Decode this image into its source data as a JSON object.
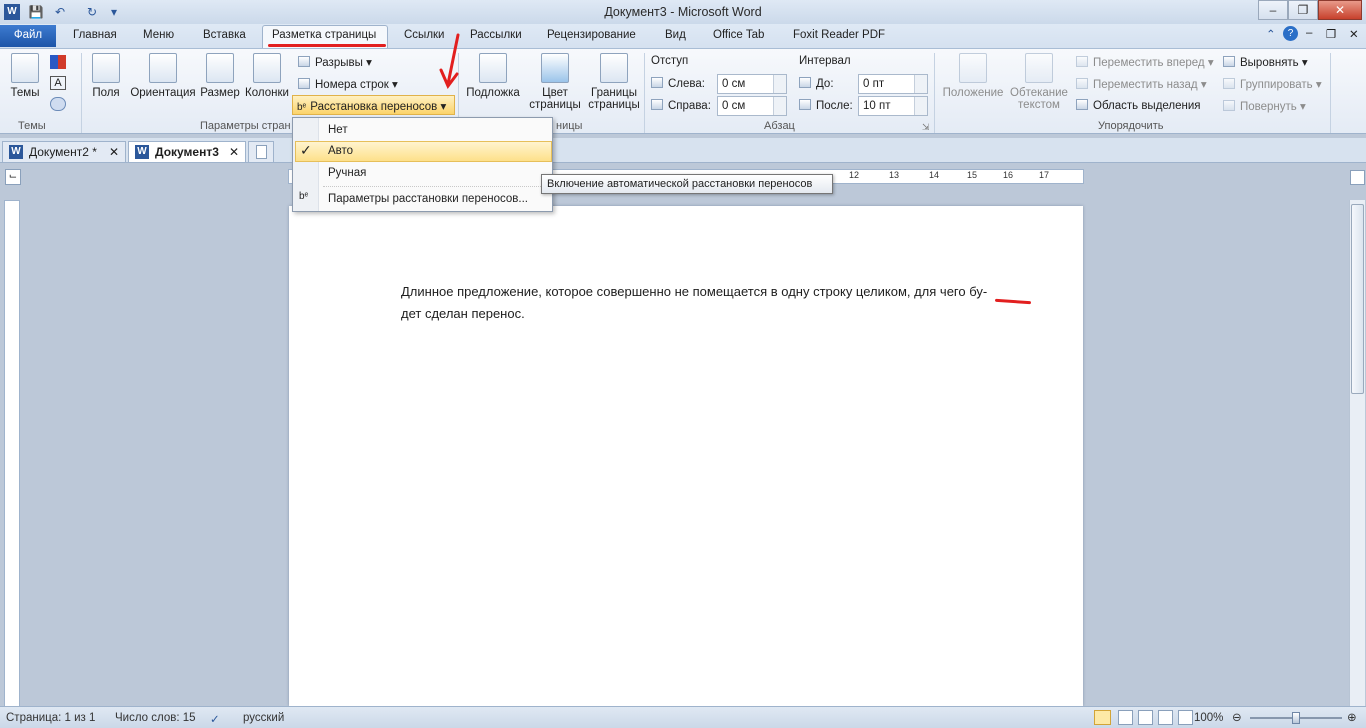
{
  "window": {
    "title": "Документ3 - Microsoft Word"
  },
  "tabs": {
    "file": "Файл",
    "items": [
      "Главная",
      "Меню",
      "Вставка",
      "Разметка страницы",
      "Ссылки",
      "Рассылки",
      "Рецензирование",
      "Вид",
      "Office Tab",
      "Foxit Reader PDF"
    ],
    "active": "Разметка страницы"
  },
  "ribbon": {
    "themes": {
      "button": "Темы",
      "group": "Темы"
    },
    "page_setup": {
      "fields": "Поля",
      "orientation": "Ориентация",
      "size": "Размер",
      "columns": "Колонки",
      "breaks": "Разрывы",
      "line_numbers": "Номера строк",
      "hyphenation": "Расстановка переносов",
      "group": "Параметры стран"
    },
    "page_background": {
      "watermark": "Подложка",
      "page_color": "Цвет страницы",
      "page_borders": "Границы страницы",
      "group": "ницы"
    },
    "paragraph": {
      "indent_title": "Отступ",
      "left_label": "Слева:",
      "left_value": "0 см",
      "right_label": "Справа:",
      "right_value": "0 см",
      "spacing_title": "Интервал",
      "before_label": "До:",
      "before_value": "0 пт",
      "after_label": "После:",
      "after_value": "10 пт",
      "group": "Абзац"
    },
    "arrange": {
      "position": "Положение",
      "wrap_text": "Обтекание текстом",
      "bring_forward": "Переместить вперед",
      "send_backward": "Переместить назад",
      "selection_pane": "Область выделения",
      "align": "Выровнять",
      "group_btn": "Группировать",
      "rotate": "Повернуть",
      "group": "Упорядочить"
    }
  },
  "hyphenation_menu": {
    "items": [
      "Нет",
      "Авто",
      "Ручная",
      "Параметры расстановки переносов..."
    ],
    "checked": "Авто"
  },
  "tooltip": "Включение автоматической расстановки переносов",
  "doc_tabs": [
    {
      "label": "Документ2 *"
    },
    {
      "label": "Документ3"
    }
  ],
  "ruler": {
    "ticks": [
      "12",
      "13",
      "14",
      "15",
      "16",
      "17"
    ]
  },
  "document": {
    "line1": "Длинное предложение, которое совершенно не помещается в одну строку целиком, для чего бу-",
    "line2": "дет сделан перенос."
  },
  "status": {
    "page": "Страница: 1 из 1",
    "words": "Число слов: 15",
    "language": "русский",
    "zoom": "100%"
  },
  "colors": {
    "accent": "#2b579a",
    "annotation": "#e21f1f",
    "highlight": "#fbe48c"
  }
}
